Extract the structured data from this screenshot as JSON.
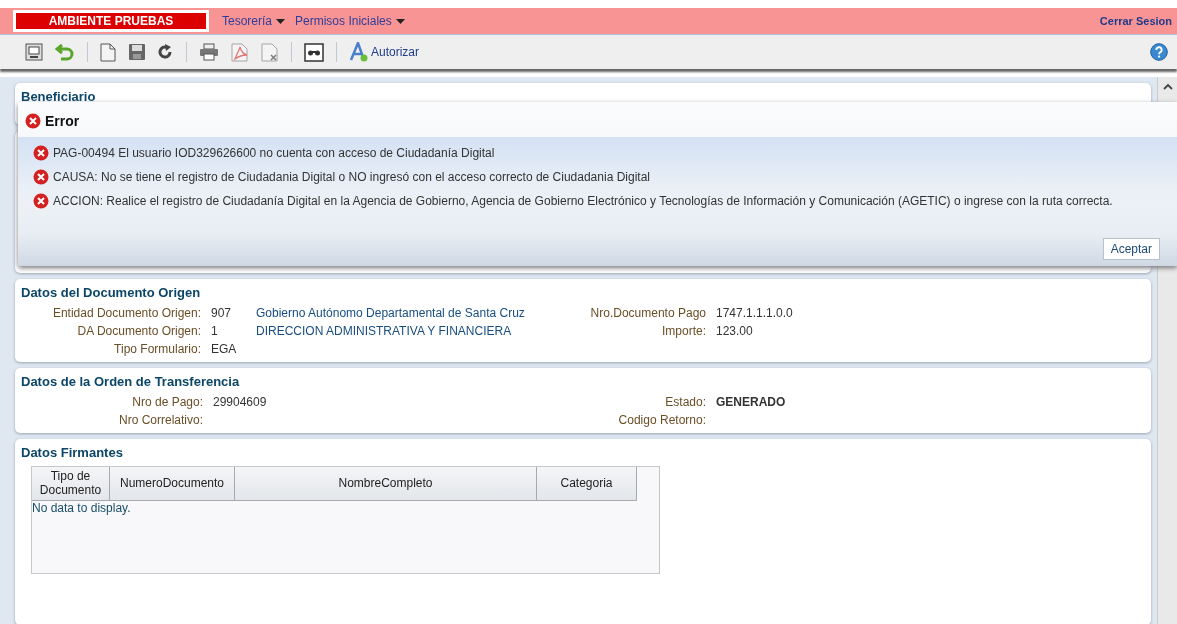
{
  "header": {
    "environment": "AMBIENTE PRUEBAS",
    "menus": [
      {
        "label": "Tesorería"
      },
      {
        "label": "Permisos Iniciales"
      }
    ],
    "logout": "Cerrar Sesion"
  },
  "toolbar": {
    "authorize": "Autorizar"
  },
  "beneficiario": {
    "title": "Beneficiario"
  },
  "documento_origen": {
    "title": "Datos del Documento Origen",
    "left": [
      {
        "label": "Entidad Documento Origen:",
        "value": "907",
        "description": "Gobierno Autónomo Departamental de Santa Cruz"
      },
      {
        "label": "DA Documento Origen:",
        "value": "1",
        "description": "DIRECCION ADMINISTRATIVA Y FINANCIERA"
      },
      {
        "label": "Tipo Formulario:",
        "value": "EGA"
      }
    ],
    "right": [
      {
        "label": "Nro.Documento Pago",
        "value": "1747.1.1.1.0.0"
      },
      {
        "label": "Importe:",
        "value": "123.00"
      }
    ]
  },
  "orden_transferencia": {
    "title": "Datos de la Orden de Transferencia",
    "left": [
      {
        "label": "Nro de Pago:",
        "value": "29904609"
      },
      {
        "label": "Nro Correlativo:"
      }
    ],
    "right": [
      {
        "label": "Estado:",
        "value": "GENERADO",
        "bold": true
      },
      {
        "label": "Codigo Retorno:"
      }
    ]
  },
  "firmantes": {
    "title": "Datos Firmantes",
    "columns": [
      "Tipo de Documento",
      "NumeroDocumento",
      "NombreCompleto",
      "Categoria"
    ],
    "empty_text": "No data to display."
  },
  "dialog": {
    "title": "Error",
    "messages": [
      "PAG-00494 El usuario IOD329626600 no cuenta con acceso de Ciudadanía Digital",
      "CAUSA: No se tiene el registro de Ciudadania Digital o NO ingresó con el acceso correcto de Ciudadania Digital",
      "ACCION: Realice el registro de Ciudadanía Digital en la Agencia de Gobierno, Agencia de Gobierno Electrónico y Tecnologías de Información y Comunicación (AGETIC) o ingrese con la ruta correcta."
    ],
    "button": "Aceptar"
  }
}
